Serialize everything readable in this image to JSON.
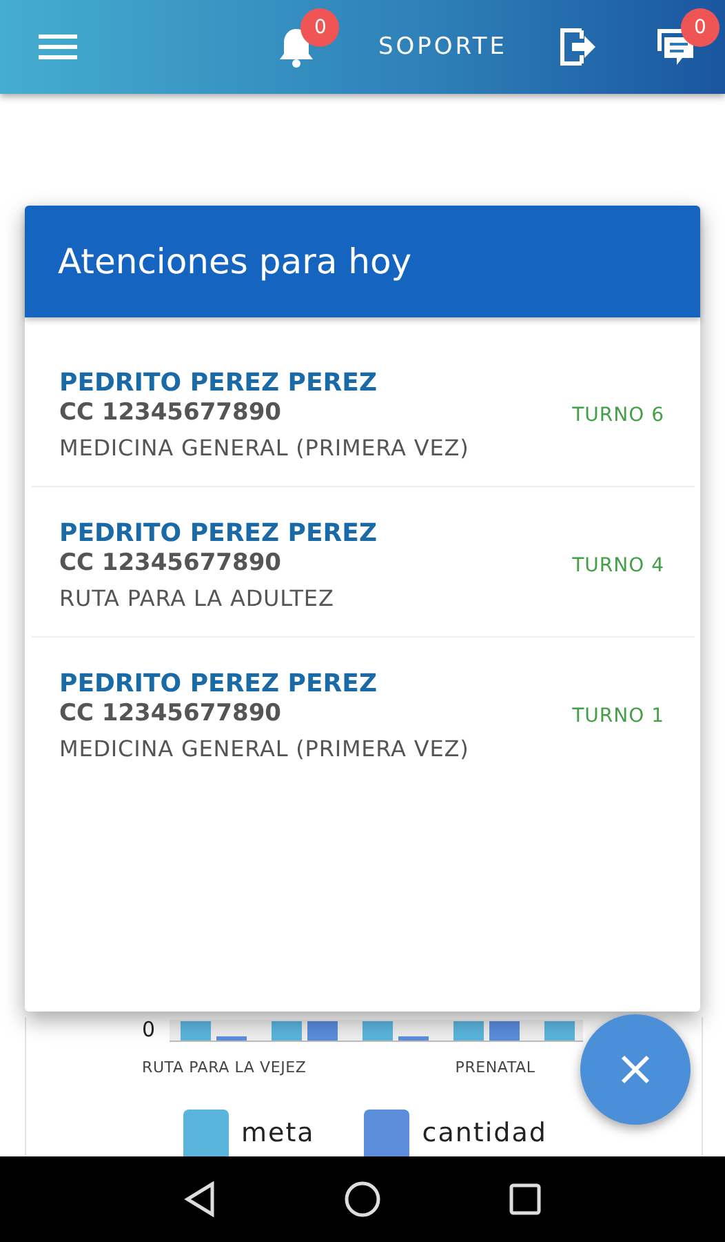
{
  "app_bar": {
    "notifications_badge": "0",
    "support_label": "SOPORTE",
    "messages_badge": "0"
  },
  "chart": {
    "y_tick": "0",
    "categories": [
      "RUTA PARA LA VEJEZ",
      "PRENATAL"
    ],
    "legend": [
      {
        "label": "meta",
        "color": "#5ab4dc"
      },
      {
        "label": "cantidad",
        "color": "#5b8ddb"
      }
    ]
  },
  "dialog": {
    "title": "Atenciones para hoy",
    "items": [
      {
        "name": "PEDRITO PEREZ PEREZ",
        "document": "CC 12345677890",
        "service": "MEDICINA GENERAL (PRIMERA VEZ)",
        "turn": "TURNO 6"
      },
      {
        "name": "PEDRITO PEREZ PEREZ",
        "document": "CC 12345677890",
        "service": "RUTA PARA LA ADULTEZ",
        "turn": "TURNO 4"
      },
      {
        "name": "PEDRITO PEREZ PEREZ",
        "document": "CC 12345677890",
        "service": "MEDICINA GENERAL (PRIMERA VEZ)",
        "turn": "TURNO 1"
      }
    ]
  }
}
